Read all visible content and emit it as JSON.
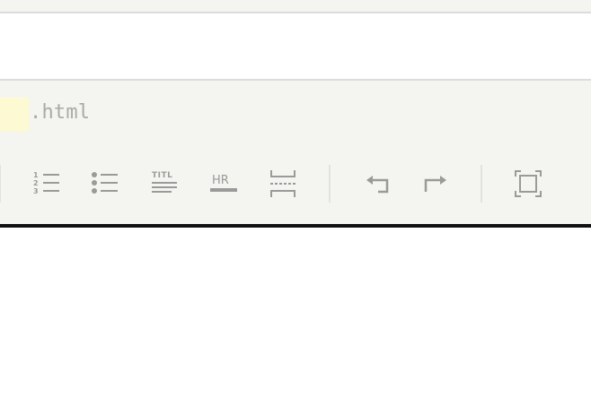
{
  "editor": {
    "filename_ext": ".html"
  },
  "toolbar": {
    "buttons": [
      {
        "name": "ordered-list",
        "icon": "ordered-list-icon"
      },
      {
        "name": "unordered-list",
        "icon": "unordered-list-icon"
      },
      {
        "name": "title",
        "icon": "title-icon",
        "glyph": "TITL"
      },
      {
        "name": "horizontal-rule",
        "icon": "hr-icon",
        "glyph": "HR"
      },
      {
        "name": "page-break",
        "icon": "page-break-icon"
      },
      {
        "name": "undo",
        "icon": "undo-icon"
      },
      {
        "name": "redo",
        "icon": "redo-icon"
      },
      {
        "name": "fullscreen",
        "icon": "fullscreen-icon"
      }
    ]
  },
  "colors": {
    "toolbar_bg": "#f4f4f1",
    "icon": "#9a9a98",
    "highlight": "#fdf9d2",
    "divider": "#dcdcda"
  }
}
